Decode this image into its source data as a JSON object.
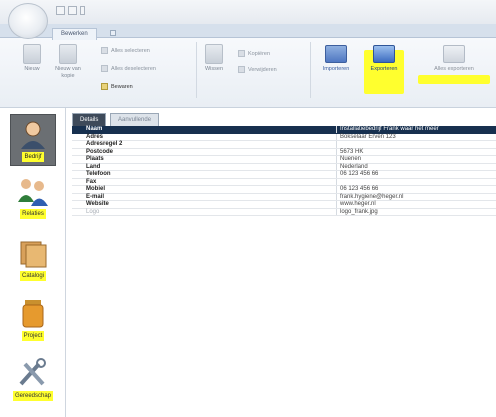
{
  "ribbon": {
    "tab_home": "Bewerken",
    "buttons": {
      "nieuw": "Nieuw",
      "nieuw_van_kopie": [
        "Nieuw van",
        "kopie"
      ],
      "verwijderen": "Wissen",
      "importeren": "Importeren",
      "exporteren": "Exporteren",
      "alles_exporteren": "Alles exporteren"
    },
    "small": {
      "alles_selecteren": "Alles selecteren",
      "alles_deselecteren": "Alles deselecteren",
      "bewaren": "Bewaren",
      "kopieren": "Kopiëren",
      "verwijderen": "Verwijderen"
    }
  },
  "nav": {
    "items": [
      {
        "label": "Bedrijf",
        "icon": "person-icon",
        "active": true
      },
      {
        "label": "Relaties",
        "icon": "people-icon",
        "active": false
      },
      {
        "label": "Catalogi",
        "icon": "folders-icon",
        "active": false
      },
      {
        "label": "Project",
        "icon": "jar-icon",
        "active": false
      },
      {
        "label": "Gereedschap",
        "icon": "tools-icon",
        "active": false
      }
    ]
  },
  "content": {
    "tabs": [
      "Details",
      "Aanvullende"
    ],
    "rows": [
      {
        "key": "Naam",
        "value": "Installatiebedrijf Frank waar het meer"
      },
      {
        "key": "Adres",
        "value": "Bokselaar Erven 123"
      },
      {
        "key": "Adresregel 2",
        "value": ""
      },
      {
        "key": "Postcode",
        "value": "5673 HK"
      },
      {
        "key": "Plaats",
        "value": "Nuenen"
      },
      {
        "key": "Land",
        "value": "Nederland"
      },
      {
        "key": "Telefoon",
        "value": "06 123 456 66"
      },
      {
        "key": "Fax",
        "value": ""
      },
      {
        "key": "Mobiel",
        "value": "06 123 456 66"
      },
      {
        "key": "E-mail",
        "value": "frank.hygiene@heger.nl"
      },
      {
        "key": "Website",
        "value": "www.heger.nl"
      },
      {
        "key": "Logo",
        "value": "logo_frank.jpg"
      }
    ]
  },
  "colors": {
    "highlight": "#ffff2e",
    "selected_row": "#17304f",
    "nav_active": "#6b6f73",
    "tab_active": "#3e4a5a"
  }
}
